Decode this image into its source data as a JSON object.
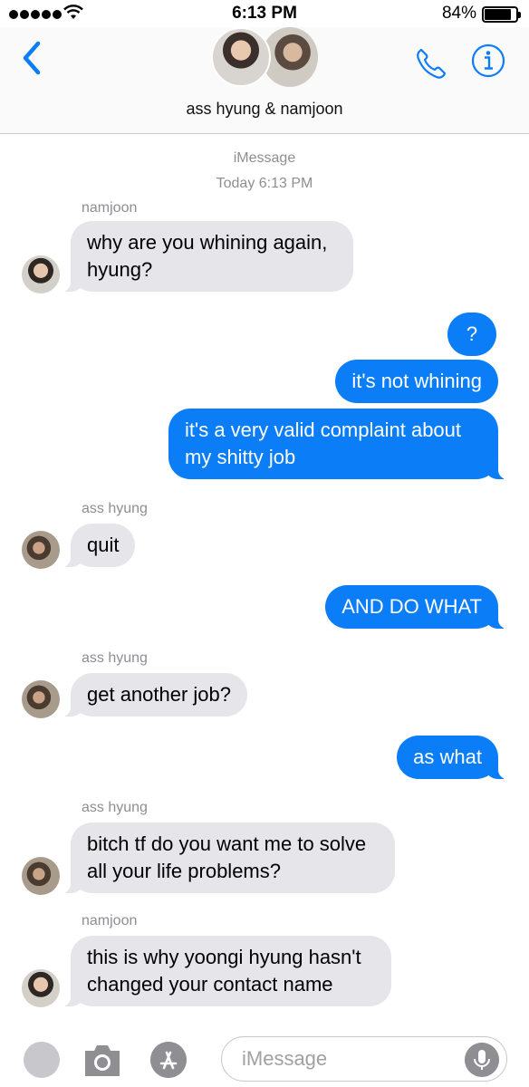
{
  "status_bar": {
    "time": "6:13 PM",
    "battery": "84%"
  },
  "header": {
    "group_name": "ass hyung  & namjoon"
  },
  "thread": {
    "service": "iMessage",
    "timestamp": "Today 6:13 PM"
  },
  "messages": [
    {
      "from": "namjoon",
      "sender_label": "namjoon",
      "text": "why are you whining again, hyung?"
    },
    {
      "from": "me",
      "text": "?"
    },
    {
      "from": "me",
      "text": "it's not whining"
    },
    {
      "from": "me",
      "text": "it's a very valid complaint about my shitty job"
    },
    {
      "from": "ass hyung",
      "sender_label": "ass hyung",
      "text": "quit"
    },
    {
      "from": "me",
      "text": "AND DO WHAT"
    },
    {
      "from": "ass hyung",
      "sender_label": "ass hyung",
      "text": "get another job?"
    },
    {
      "from": "me",
      "text": "as what"
    },
    {
      "from": "ass hyung",
      "sender_label": "ass hyung",
      "text": "bitch tf do you want me to solve all your life problems?"
    },
    {
      "from": "namjoon",
      "sender_label": "namjoon",
      "text": "this is why yoongi hyung hasn't changed your contact name"
    }
  ],
  "input": {
    "placeholder": "iMessage"
  },
  "colors": {
    "outgoing": "#0b7ef7",
    "incoming": "#e5e5ea",
    "accent": "#0b7ef7"
  },
  "icons": [
    "chevron-left-icon",
    "phone-icon",
    "info-icon",
    "camera-icon",
    "appstore-icon",
    "mic-icon",
    "apps-icon"
  ]
}
